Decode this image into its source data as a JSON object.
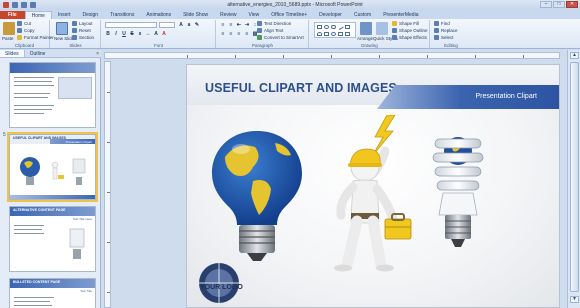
{
  "window": {
    "title": "alternative_energies_2010_5689.pptx - Microsoft PowerPoint",
    "controls": [
      "–",
      "□",
      "✕"
    ]
  },
  "tabs": [
    "File",
    "Home",
    "Insert",
    "Design",
    "Transitions",
    "Animations",
    "Slide Show",
    "Review",
    "View",
    "Office Timeline+",
    "Developer",
    "Custom",
    "PresenterMedia"
  ],
  "ribbon": {
    "clipboard": {
      "label": "Clipboard",
      "paste": "Paste",
      "cut": "Cut",
      "copy": "Copy",
      "format_painter": "Format Painter"
    },
    "slides": {
      "label": "Slides",
      "new_slide": "New Slide",
      "layout": "Layout",
      "reset": "Reset",
      "section": "Section"
    },
    "font": {
      "label": "Font",
      "font_name": "",
      "font_size": ""
    },
    "paragraph": {
      "label": "Paragraph",
      "text_direction": "Text Direction",
      "align_text": "Align Text",
      "smartart": "Convert to SmartArt"
    },
    "drawing": {
      "label": "Drawing",
      "arrange": "Arrange",
      "quick_styles": "Quick Styles",
      "shape_fill": "Shape Fill",
      "shape_outline": "Shape Outline",
      "shape_effects": "Shape Effects"
    },
    "editing": {
      "label": "Editing",
      "find": "Find",
      "replace": "Replace",
      "select": "Select"
    }
  },
  "left_pane": {
    "tabs": [
      "Slides",
      "Outline"
    ],
    "close": "×",
    "thumbnails": [
      {
        "number": "",
        "title": "",
        "subtitle": ""
      },
      {
        "number": "5",
        "title": "USEFUL CLIPART AND IMAGES",
        "subtitle": "Presentation Clipart"
      },
      {
        "number": "",
        "title": "ALTERNATIVE CONTENT PAGE",
        "subtitle": "Sub Title Here"
      },
      {
        "number": "",
        "title": "BULLETED CONTENT PAGE",
        "subtitle": "Sub Title"
      }
    ]
  },
  "slide": {
    "title": "USEFUL CLIPART AND IMAGES",
    "subtitle": "Presentation Clipart",
    "logo_text": "YOUR LOGO"
  },
  "scrollbar": {
    "up": "▲",
    "down": "▼"
  }
}
